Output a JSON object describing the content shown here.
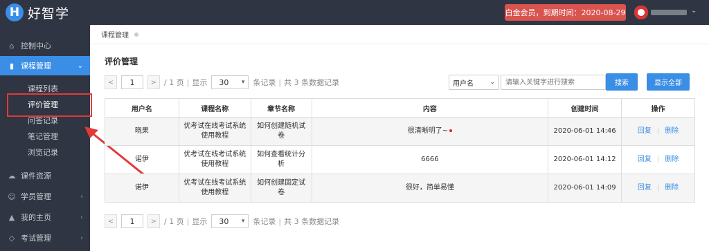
{
  "app": {
    "logo_letter": "H",
    "name": "好智学"
  },
  "header": {
    "membership": "白金会员，到期时间：2020-08-29"
  },
  "sidebar": {
    "items": [
      {
        "label": "控制中心",
        "icon": "home-icon"
      },
      {
        "label": "课程管理",
        "icon": "book-icon"
      },
      {
        "label": "课件资源",
        "icon": "cloud-icon"
      },
      {
        "label": "学员管理",
        "icon": "users-icon"
      },
      {
        "label": "我的主页",
        "icon": "mortarboard-icon"
      },
      {
        "label": "考试管理",
        "icon": "tag-icon"
      }
    ],
    "sub_items": [
      "课程列表",
      "评价管理",
      "问答记录",
      "笔记管理",
      "浏览记录"
    ]
  },
  "breadcrumb": "课程管理",
  "page_title": "评价管理",
  "pager": {
    "prev": "<",
    "next": ">",
    "page": "1",
    "page_total": "/ 1 页",
    "sep": "|",
    "show": "显示",
    "page_size": "30",
    "records": "条记录",
    "total": "共 3 条数据记录"
  },
  "filter": {
    "field": "用户名",
    "placeholder": "请输入关键字进行搜索",
    "search_label": "搜索",
    "show_all_label": "显示全部"
  },
  "table": {
    "headers": [
      "用户名",
      "课程名称",
      "章节名称",
      "内容",
      "创建时间",
      "操作"
    ],
    "rows": [
      {
        "user": "晓果",
        "course": "优考试在线考试系统使用教程",
        "chapter": "如何创建随机试卷",
        "content": "很清晰明了~",
        "time": "2020-06-01 14:46"
      },
      {
        "user": "诺伊",
        "course": "优考试在线考试系统使用教程",
        "chapter": "如何查看统计分析",
        "content": "6666",
        "time": "2020-06-01 14:12"
      },
      {
        "user": "诺伊",
        "course": "优考试在线考试系统使用教程",
        "chapter": "如何创建固定试卷",
        "content": "很好，简单易懂",
        "time": "2020-06-01 14:09"
      }
    ],
    "actions": {
      "reply": "回复",
      "sep": "|",
      "delete": "删除"
    }
  },
  "colors": {
    "topbar": "#2f3542",
    "accent": "#3a8ee6",
    "member_badge": "#d9534f",
    "annotation": "#e03a3a"
  }
}
